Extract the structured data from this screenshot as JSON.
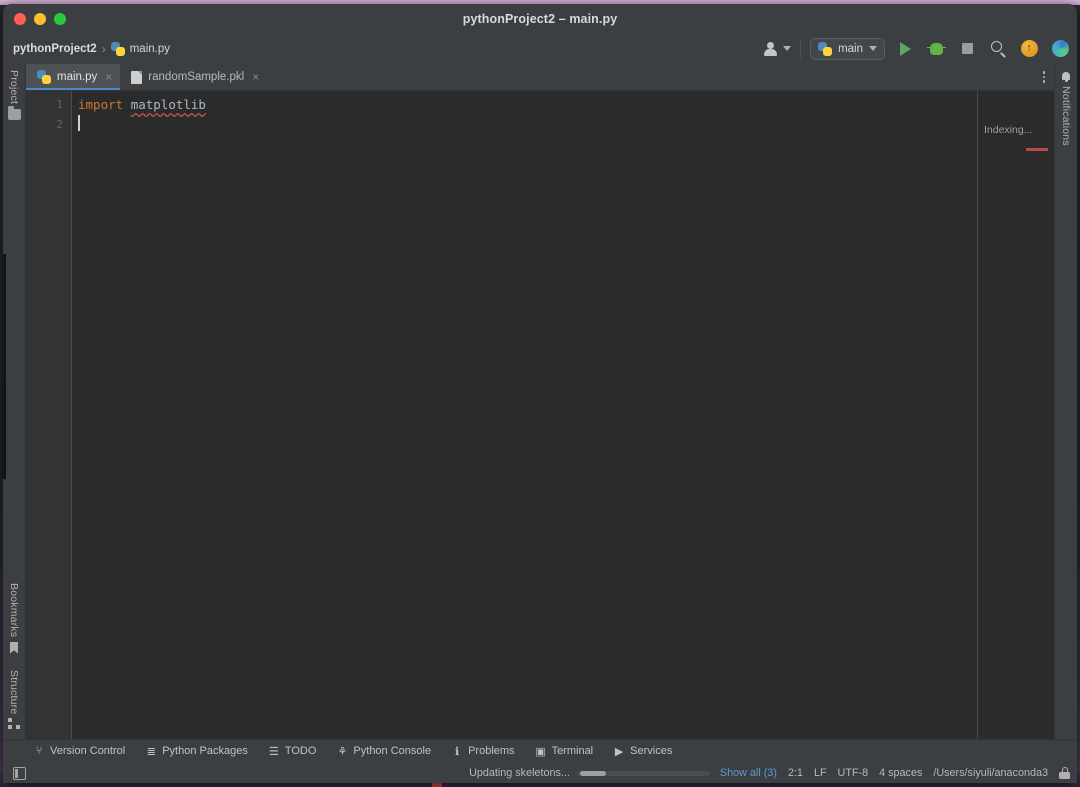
{
  "window": {
    "title": "pythonProject2 – main.py",
    "traffic_lights": [
      "close",
      "minimize",
      "zoom"
    ]
  },
  "toolbar": {
    "breadcrumb": {
      "project": "pythonProject2",
      "separator": "›",
      "file": "main.py",
      "file_icon": "python-file-icon"
    },
    "account_icon": "user-account-icon",
    "run_config": {
      "label": "main",
      "icon": "python-config-icon",
      "dropdown_icon": "chevron-down-icon"
    },
    "run_button": "run-icon",
    "debug_button": "debug-icon",
    "stop_button": "stop-icon",
    "search_button": "search-icon",
    "updates_button": "update-available-icon",
    "ai_button": "ai-assistant-icon"
  },
  "left_strip": {
    "top_items": [
      {
        "label": "Project",
        "icon": "folder-icon"
      }
    ],
    "bottom_items": [
      {
        "label": "Bookmarks",
        "icon": "bookmark-icon"
      },
      {
        "label": "Structure",
        "icon": "structure-icon"
      }
    ]
  },
  "right_strip": {
    "items": [
      {
        "label": "Notifications",
        "icon": "bell-icon"
      }
    ]
  },
  "editor": {
    "tabs": [
      {
        "label": "main.py",
        "icon": "python-file-icon",
        "close": "×",
        "active": true
      },
      {
        "label": "randomSample.pkl",
        "icon": "binary-file-icon",
        "close": "×",
        "active": false
      }
    ],
    "more_icon": "more-options-icon",
    "line_numbers": [
      "1",
      "2"
    ],
    "code": {
      "line1_keyword": "import",
      "line1_module": "matplotlib",
      "line2": ""
    },
    "indexing_status": "Indexing...",
    "error_stripe_color": "#b84c4c"
  },
  "tool_windows": [
    {
      "label": "Version Control",
      "icon": "branch-icon"
    },
    {
      "label": "Python Packages",
      "icon": "packages-icon"
    },
    {
      "label": "TODO",
      "icon": "todo-list-icon"
    },
    {
      "label": "Python Console",
      "icon": "python-console-icon"
    },
    {
      "label": "Problems",
      "icon": "problems-icon"
    },
    {
      "label": "Terminal",
      "icon": "terminal-icon"
    },
    {
      "label": "Services",
      "icon": "services-icon"
    }
  ],
  "status_bar": {
    "layout_icon": "layout-toggle-icon",
    "progress_text": "Updating skeletons...",
    "show_all": "Show all (3)",
    "caret_position": "2:1",
    "line_separator": "LF",
    "encoding": "UTF-8",
    "indent": "4 spaces",
    "interpreter_path": "/Users/siyuli/anaconda3",
    "lock_icon": "lock-icon"
  },
  "colors": {
    "chrome": "#3c3f41",
    "editor_bg": "#2b2b2b",
    "gutter_bg": "#313335",
    "tab_active": "#4e5254",
    "tab_underline": "#4a88c7",
    "accent_link": "#5e9ad6",
    "run_green": "#59a869",
    "error_red": "#b84c4c",
    "keyword_orange": "#cc7832"
  }
}
